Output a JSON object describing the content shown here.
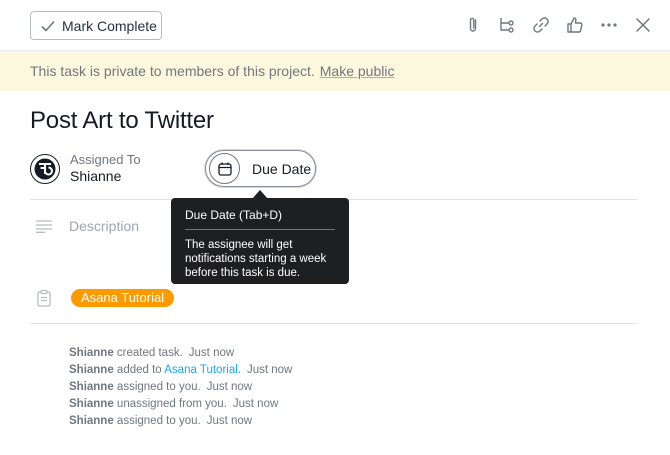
{
  "toolbar": {
    "mark_complete_label": "Mark Complete",
    "icons": [
      "attachment-icon",
      "subtask-icon",
      "link-icon",
      "like-icon",
      "more-icon",
      "close-icon"
    ]
  },
  "banner": {
    "text": "This task is private to members of this project.",
    "link": "Make public"
  },
  "task": {
    "title": "Post Art to Twitter",
    "assigned_label": "Assigned To",
    "assignee": "Shianne",
    "due_date_label": "Due Date",
    "description_placeholder": "Description",
    "project": "Asana Tutorial"
  },
  "tooltip": {
    "title": "Due Date (Tab+D)",
    "body": "The assignee will get notifications starting a week before this task is due."
  },
  "activity": [
    {
      "user": "Shianne",
      "action": " created task.",
      "link": "",
      "after": "",
      "time": "Just now"
    },
    {
      "user": "Shianne",
      "action": " added to ",
      "link": "Asana Tutorial",
      "after": ".",
      "time": "Just now"
    },
    {
      "user": "Shianne",
      "action": " assigned to you.",
      "link": "",
      "after": "",
      "time": "Just now"
    },
    {
      "user": "Shianne",
      "action": " unassigned from you.",
      "link": "",
      "after": "",
      "time": "Just now"
    },
    {
      "user": "Shianne",
      "action": " assigned to you.",
      "link": "",
      "after": "",
      "time": "Just now"
    }
  ],
  "colors": {
    "banner_bg": "#fcf8dd",
    "project_tag": "#fd9a00",
    "link": "#14aaf5",
    "tooltip_bg": "#1e1f21"
  }
}
